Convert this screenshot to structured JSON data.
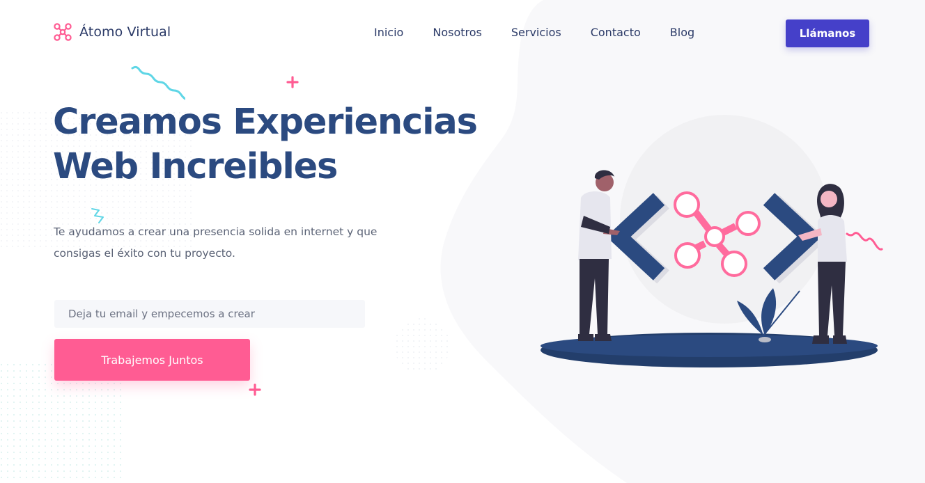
{
  "brand": {
    "name": "Átomo Virtual",
    "logo_icon": "atom-nodes-icon",
    "accent_color": "#ff5c93"
  },
  "nav": {
    "items": [
      "Inicio",
      "Nosotros",
      "Servicios",
      "Contacto",
      "Blog"
    ],
    "cta_label": "Llámanos",
    "cta_color": "#4540c9"
  },
  "hero": {
    "title": "Creamos Experiencias\nWeb Increibles",
    "subtitle": "Te ayudamos a crear una presencia solida en internet y que\nconsigas el éxito con tu proyecto.",
    "email_placeholder": "Deja tu email y empecemos a crear",
    "cta_label": "Trabajemos Juntos",
    "cta_color": "#ff5c93",
    "title_color": "#2b4a80"
  },
  "illustration": {
    "subject": "people-with-code-brackets-illustration",
    "icons": [
      "left-chevron-bracket-icon",
      "molecule-nodes-icon",
      "right-chevron-bracket-icon",
      "plant-icon"
    ]
  }
}
